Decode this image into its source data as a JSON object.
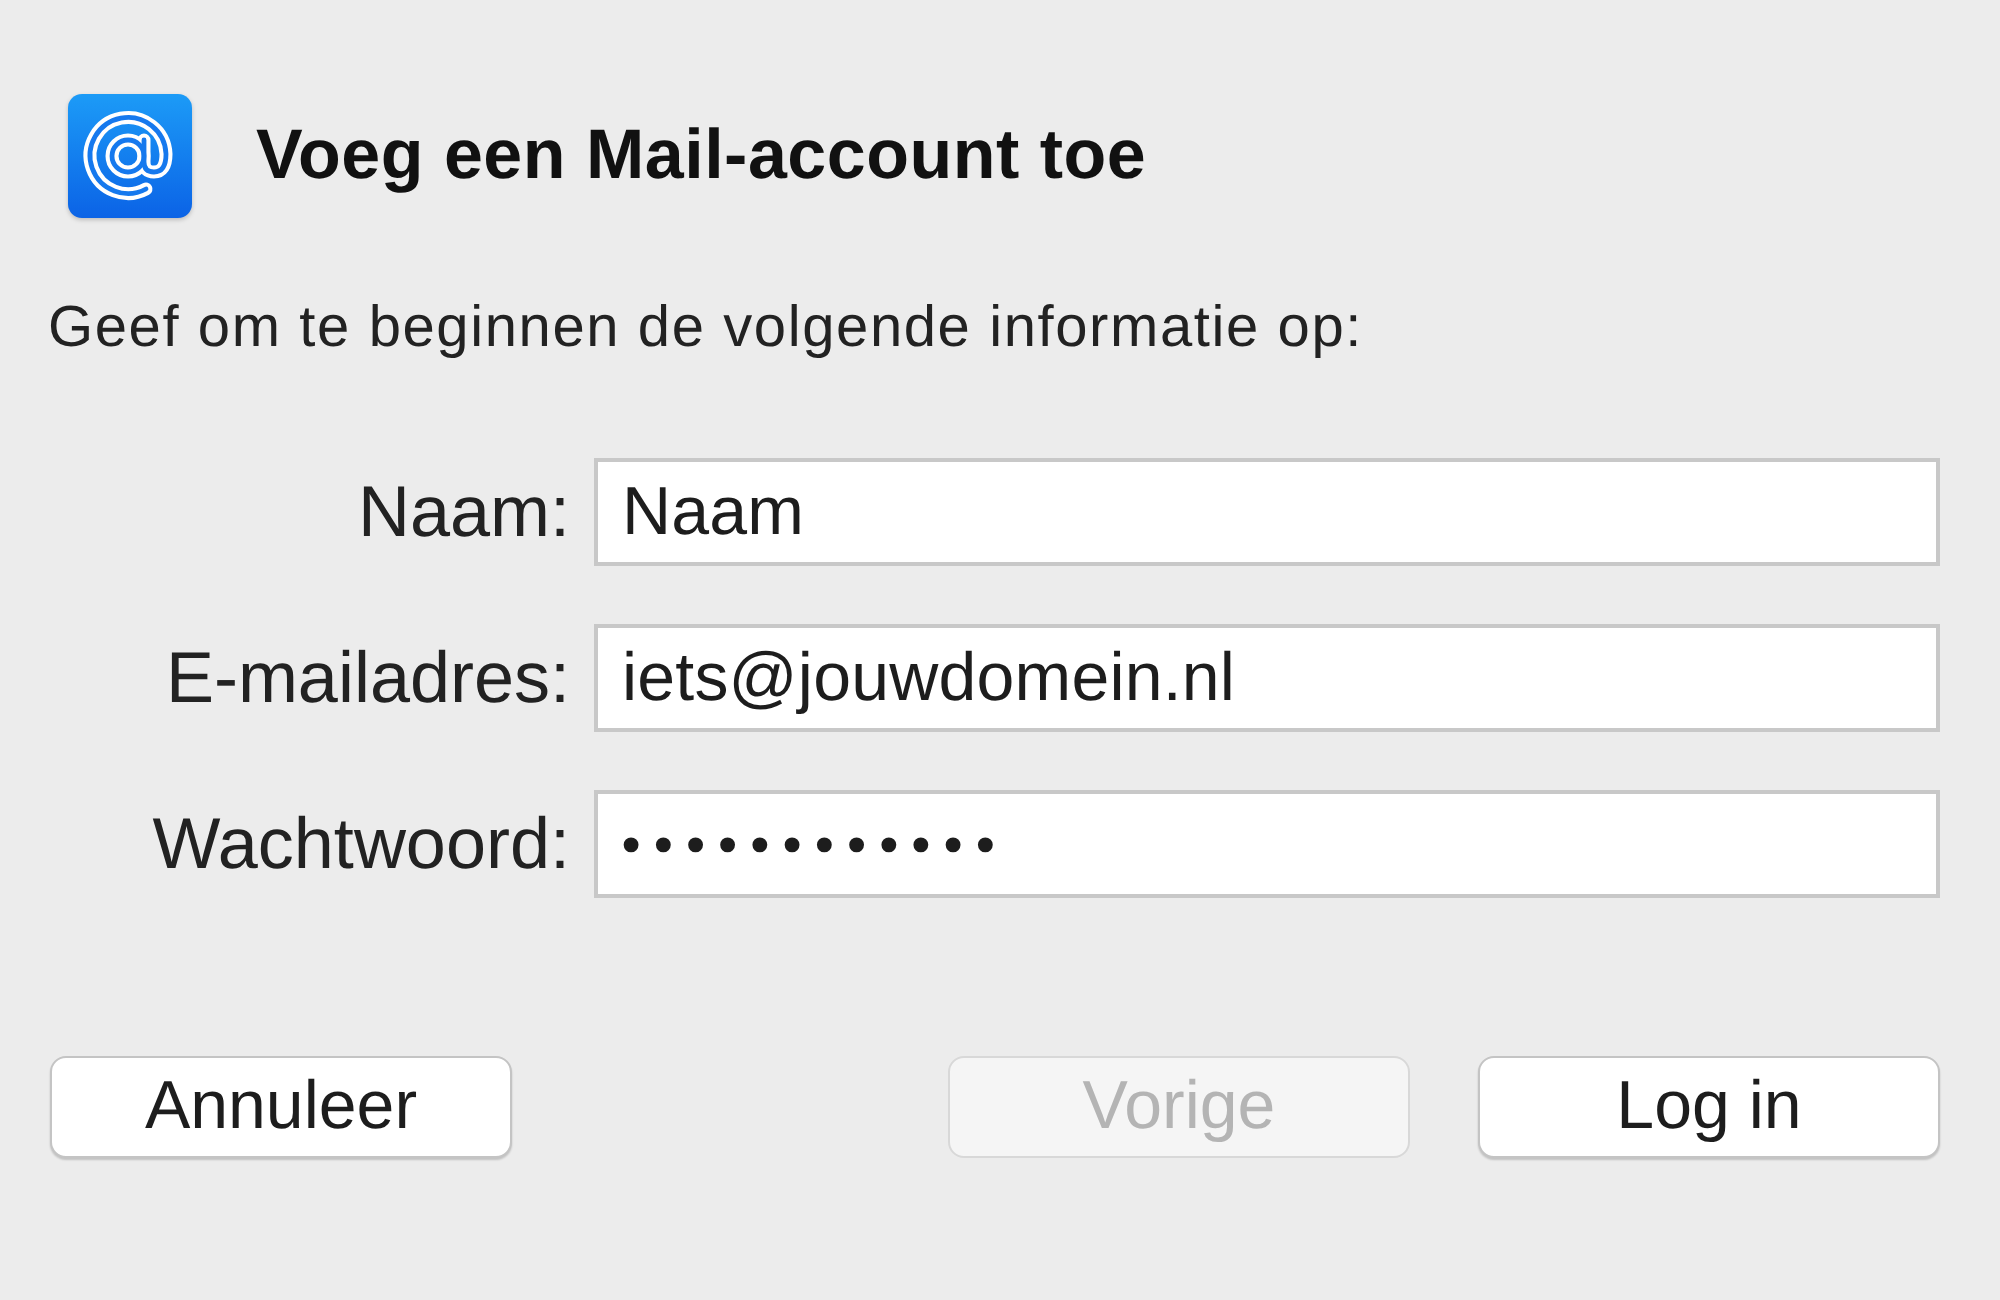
{
  "dialog": {
    "title": "Voeg een Mail-account toe",
    "instruction": "Geef om te beginnen de volgende informatie op:"
  },
  "fields": [
    {
      "label": "Naam:",
      "value": "Naam",
      "kind": "text"
    },
    {
      "label": "E-mailadres:",
      "value": "iets@jouwdomein.nl",
      "kind": "text"
    },
    {
      "label": "Wachtwoord:",
      "value": "••••••••••••",
      "kind": "password"
    }
  ],
  "buttons": {
    "left": [
      {
        "label": "Annuleer",
        "disabled": false
      }
    ],
    "right": [
      {
        "label": "Vorige",
        "disabled": true
      },
      {
        "label": "Log in",
        "disabled": false
      }
    ]
  }
}
